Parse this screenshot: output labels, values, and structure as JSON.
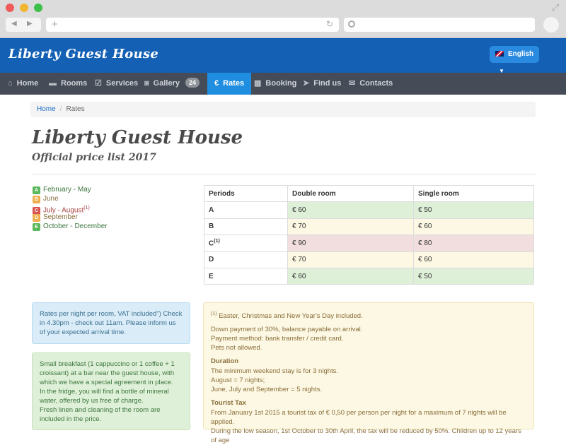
{
  "browser": {
    "back": "◀",
    "forward": "▶",
    "new_tab": "+",
    "reload": "↻"
  },
  "header": {
    "brand": "Liberty Guest House",
    "language": "English"
  },
  "menu": {
    "items": [
      {
        "label": "Home",
        "icon": "⌂"
      },
      {
        "label": "Rooms",
        "icon": "▬"
      },
      {
        "label": "Services",
        "icon": "☑"
      },
      {
        "label": "Gallery",
        "icon": "◙",
        "badge": "24"
      },
      {
        "label": "Rates",
        "icon": "€"
      },
      {
        "label": "Booking",
        "icon": "▦"
      },
      {
        "label": "Find us",
        "icon": "➤"
      },
      {
        "label": "Contacts",
        "icon": "✉"
      }
    ]
  },
  "breadcrumb": {
    "home": "Home",
    "separator": "/",
    "current": "Rates"
  },
  "page": {
    "title": "Liberty Guest House",
    "subtitle": "Official price list 2017"
  },
  "legend": [
    {
      "letter": "A",
      "label": "February - May",
      "color": "#5cb85c",
      "text_color": "#3c763d"
    },
    {
      "letter": "B",
      "label": "June",
      "color": "#f0ad4e",
      "text_color": "#8a6d3b"
    },
    {
      "letter": "C",
      "label": "July - August",
      "sup": "(1)",
      "color": "#d9534f",
      "text_color": "#a94442"
    },
    {
      "letter": "D",
      "label": "September",
      "color": "#f0ad4e",
      "text_color": "#8a6d3b"
    },
    {
      "letter": "E",
      "label": "October - December",
      "color": "#5cb85c",
      "text_color": "#3c763d"
    }
  ],
  "rates_table": {
    "headers": [
      "Periods",
      "Double room",
      "Single room"
    ],
    "rows": [
      {
        "period": "A",
        "sup": "",
        "double": "€ 60",
        "single": "€ 50",
        "bg": "#dff0d8"
      },
      {
        "period": "B",
        "sup": "",
        "double": "€ 70",
        "single": "€ 60",
        "bg": "#fcf8e3"
      },
      {
        "period": "C",
        "sup": "(1)",
        "double": "€ 90",
        "single": "€ 80",
        "bg": "#f2dede"
      },
      {
        "period": "D",
        "sup": "",
        "double": "€ 70",
        "single": "€ 60",
        "bg": "#fcf8e3"
      },
      {
        "period": "E",
        "sup": "",
        "double": "€ 60",
        "single": "€ 50",
        "bg": "#dff0d8"
      }
    ]
  },
  "info_blue": {
    "text": "Rates per night per room, VAT included\") Check in 4.30pm - check out 11am. Please inform us of your expected arrival time."
  },
  "info_green": {
    "lines": [
      "Small breakfast (1 cappuccino or 1 coffee + 1 croissant) at a bar near the guest house, with which we have a special agreement in place.",
      "In the fridge, you will find a bottle of mineral water, offered by us free of charge.",
      "Fresh linen and cleaning of the room are included in the price."
    ]
  },
  "info_yellow": {
    "note_sup": "(1)",
    "note": " Easter, Christmas and New Year's Day included.",
    "payment": [
      "Down payment of 30%, balance payable on arrival.",
      "Payment method: bank transfer / credit card.",
      "Pets not allowed."
    ],
    "duration_title": "Duration",
    "duration": [
      "The minimum weekend stay is for 3 nights.",
      "August = 7 nights;",
      "June, July and September = 5 nights."
    ],
    "tax_title": "Tourist Tax",
    "tax": [
      "From January 1st 2015 a tourist tax of € 0,50 per person per night for a maximum of 7 nights will be applied.",
      "During the low season, 1st October to 30th April, the tax will be reduced by 50%. Children up to 12 years of age"
    ]
  }
}
